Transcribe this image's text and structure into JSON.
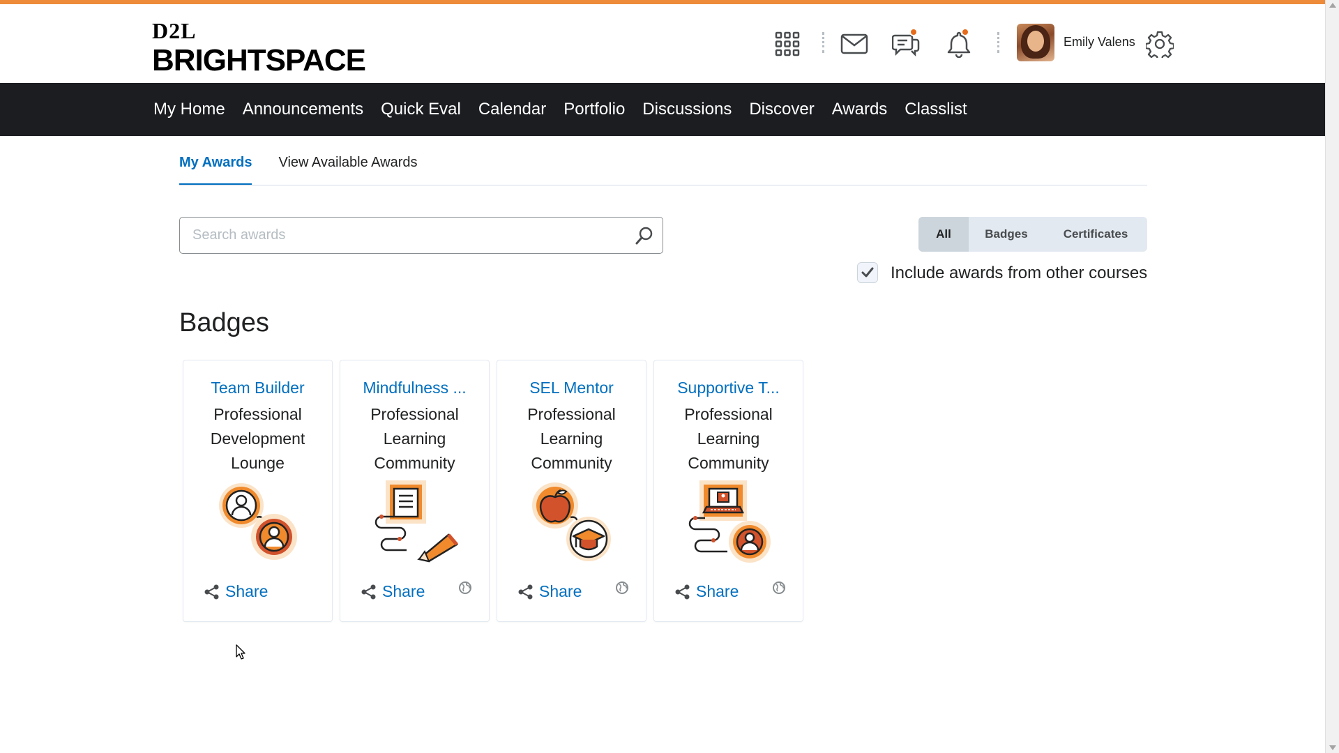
{
  "brand": {
    "line1": "D2L",
    "line2": "BRIGHTSPACE"
  },
  "header": {
    "username": "Emily Valens",
    "icons": [
      "waffle-grid-icon",
      "mail-icon",
      "chat-icon",
      "bell-icon",
      "gear-icon"
    ]
  },
  "nav": {
    "items": [
      "My Home",
      "Announcements",
      "Quick Eval",
      "Calendar",
      "Portfolio",
      "Discussions",
      "Discover",
      "Awards",
      "Classlist"
    ]
  },
  "tabs": [
    {
      "label": "My Awards",
      "active": true
    },
    {
      "label": "View Available Awards",
      "active": false
    }
  ],
  "search": {
    "placeholder": "Search awards",
    "value": ""
  },
  "filter": {
    "options": [
      "All",
      "Badges",
      "Certificates"
    ],
    "selected": "All"
  },
  "include_other": {
    "label": "Include awards from other courses",
    "checked": true
  },
  "section_title": "Badges",
  "badges": [
    {
      "title": "Team Builder",
      "subtitle": "Professional Development Lounge",
      "share_label": "Share",
      "public": false,
      "icon": "team-builder-badge-icon"
    },
    {
      "title": "Mindfulness ...",
      "subtitle": "Professional Learning Community",
      "share_label": "Share",
      "public": true,
      "icon": "mindfulness-badge-icon"
    },
    {
      "title": "SEL Mentor",
      "subtitle": "Professional Learning Community",
      "share_label": "Share",
      "public": true,
      "icon": "sel-mentor-badge-icon"
    },
    {
      "title": "Supportive T...",
      "subtitle": "Professional Learning Community",
      "share_label": "Share",
      "public": true,
      "icon": "supportive-teacher-badge-icon"
    }
  ],
  "colors": {
    "accent_orange": "#ed8b3a",
    "nav_bg": "#1b1d21",
    "link_blue": "#006fbf",
    "notification_dot": "#e66c1b"
  }
}
